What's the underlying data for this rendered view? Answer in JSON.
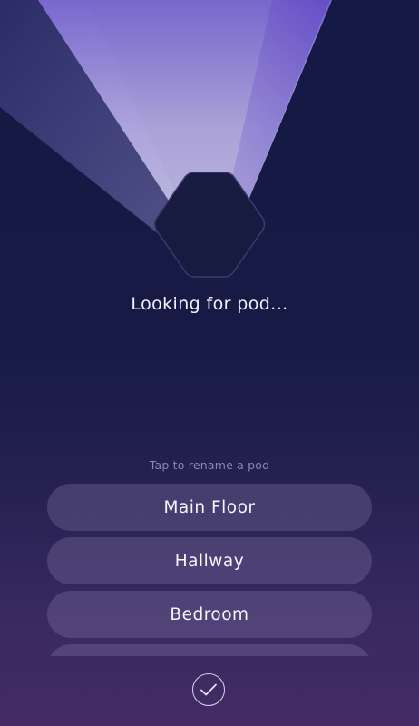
{
  "status": {
    "message": "Looking for pod..."
  },
  "hint": {
    "text": "Tap to rename a pod"
  },
  "pods": [
    {
      "name": "Main Floor"
    },
    {
      "name": "Hallway"
    },
    {
      "name": "Bedroom"
    },
    {
      "name": ""
    }
  ],
  "icons": {
    "pod": "hexagon-pod-icon",
    "confirm": "checkmark-icon"
  },
  "colors": {
    "background_top": "#141a45",
    "background_bottom": "#442b63",
    "beam": "#a69fe0",
    "pod_fill": "#171b3f",
    "row_fill": "#5e5482"
  }
}
